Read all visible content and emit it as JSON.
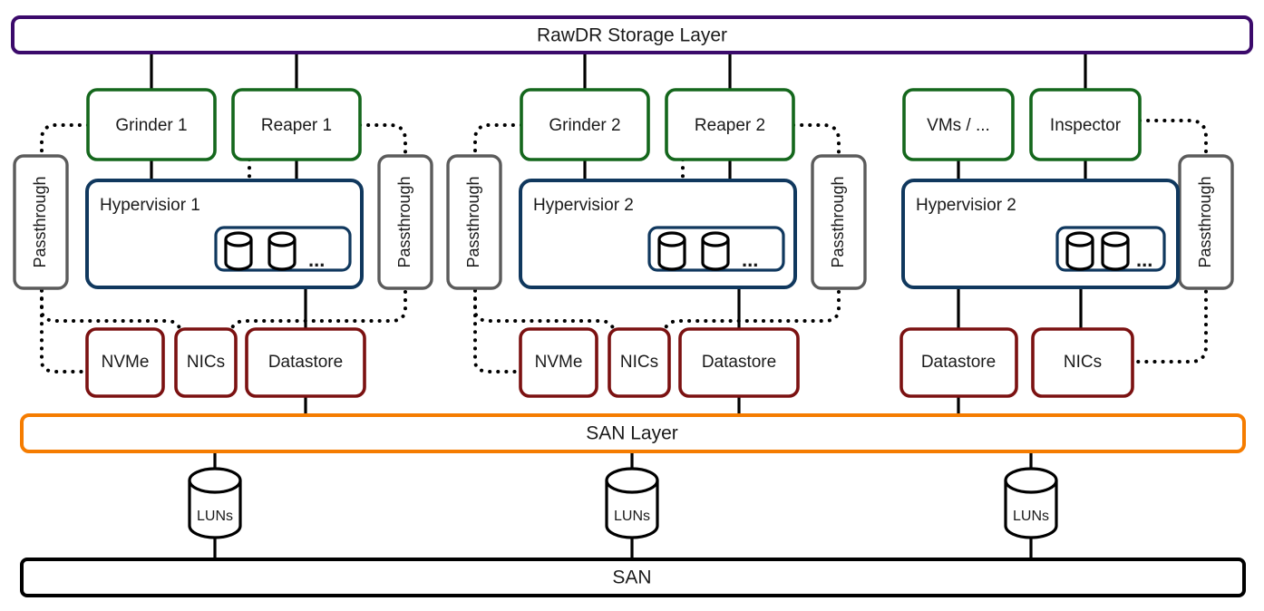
{
  "diagram": {
    "title_top": "RawDR Storage Layer",
    "title_bottom": "SAN",
    "san_layer": "SAN Layer",
    "ellipsis": "...",
    "colors": {
      "rawdr_layer": "#3B0A6B",
      "san_layer": "#F57C00",
      "san_bottom": "#000000",
      "service_node": "#14671C",
      "hypervisor": "#10385E",
      "hardware": "#7B1111",
      "passthrough": "#5B5B5B",
      "connector": "#000000",
      "text": "#1a1a1a",
      "background": "#ffffff"
    },
    "groups": [
      {
        "id": "group-1",
        "services": [
          "Grinder 1",
          "Reaper 1"
        ],
        "hypervisor": "Hypervisior 1",
        "passthrough_left": "Passthrough",
        "passthrough_right": "Passthrough",
        "hardware": [
          "NVMe",
          "NICs",
          "Datastore"
        ],
        "lun": "LUNs"
      },
      {
        "id": "group-2",
        "services": [
          "Grinder 2",
          "Reaper 2"
        ],
        "hypervisor": "Hypervisior 2",
        "passthrough_left": "Passthrough",
        "passthrough_right": "Passthrough",
        "hardware": [
          "NVMe",
          "NICs",
          "Datastore"
        ],
        "lun": "LUNs"
      },
      {
        "id": "group-3",
        "services": [
          "VMs / ...",
          "Inspector"
        ],
        "hypervisor": "Hypervisior 2",
        "passthrough_right": "Passthrough",
        "hardware": [
          "Datastore",
          "NICs"
        ],
        "lun": "LUNs"
      }
    ]
  }
}
